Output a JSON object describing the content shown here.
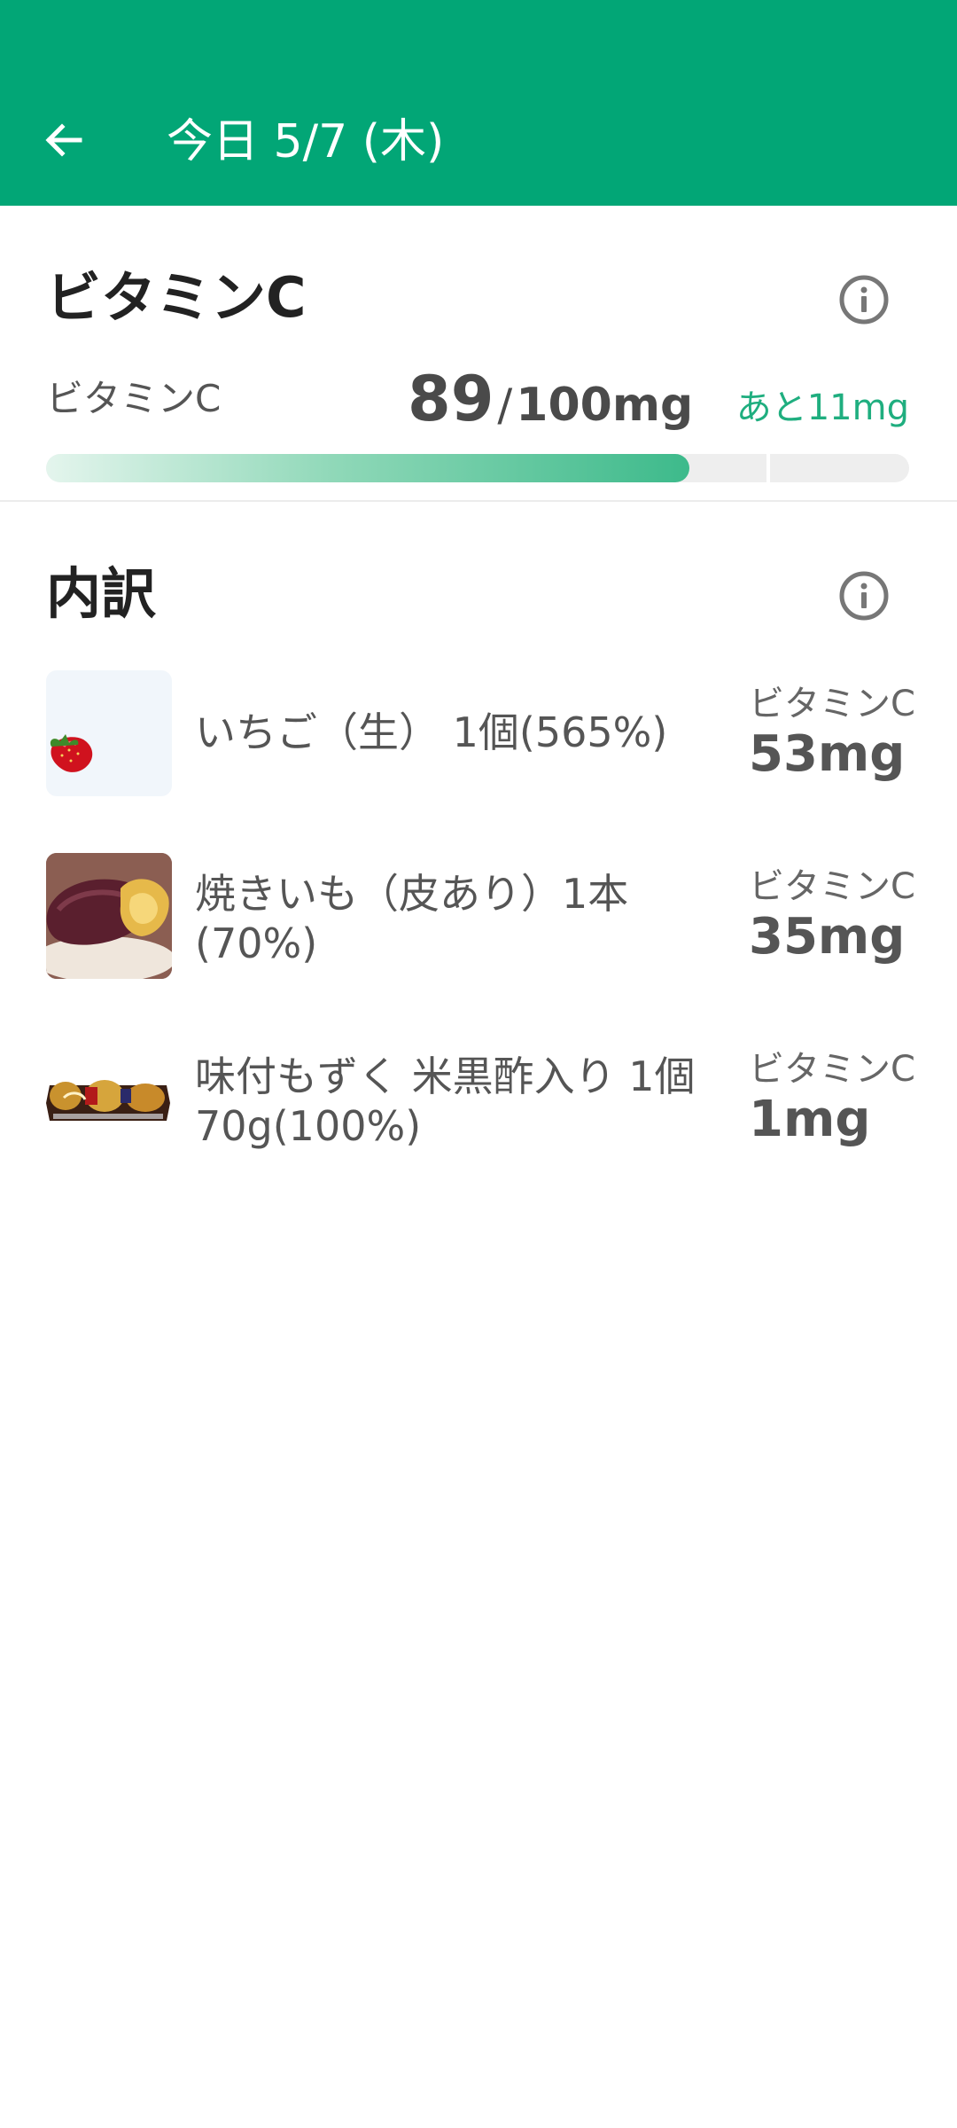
{
  "appbar": {
    "title": "今日 5/7 (木)",
    "back_icon": "arrow-left-icon",
    "background": "#02a676"
  },
  "summary": {
    "title": "ビタミンC",
    "nutrient_label": "ビタミンC",
    "current": "89",
    "separator": "/",
    "target": "100mg",
    "remaining": "あと11mg",
    "progress_fraction": 0.89,
    "accent": "#1fae7f",
    "info_icon": "info-icon"
  },
  "breakdown": {
    "title": "内訳",
    "info_icon": "info-icon",
    "items": [
      {
        "name": "いちご（生） 1個(565%)",
        "nutrient": "ビタミンC",
        "value": "53mg",
        "thumb_icon": "strawberry-image"
      },
      {
        "name": "焼きいも（皮あり）1本(70%)",
        "nutrient": "ビタミンC",
        "value": "35mg",
        "thumb_icon": "sweet-potato-image"
      },
      {
        "name": "味付もずく 米黒酢入り 1個70g(100%)",
        "nutrient": "ビタミンC",
        "value": "1mg",
        "thumb_icon": "mozuku-package-image"
      }
    ]
  }
}
